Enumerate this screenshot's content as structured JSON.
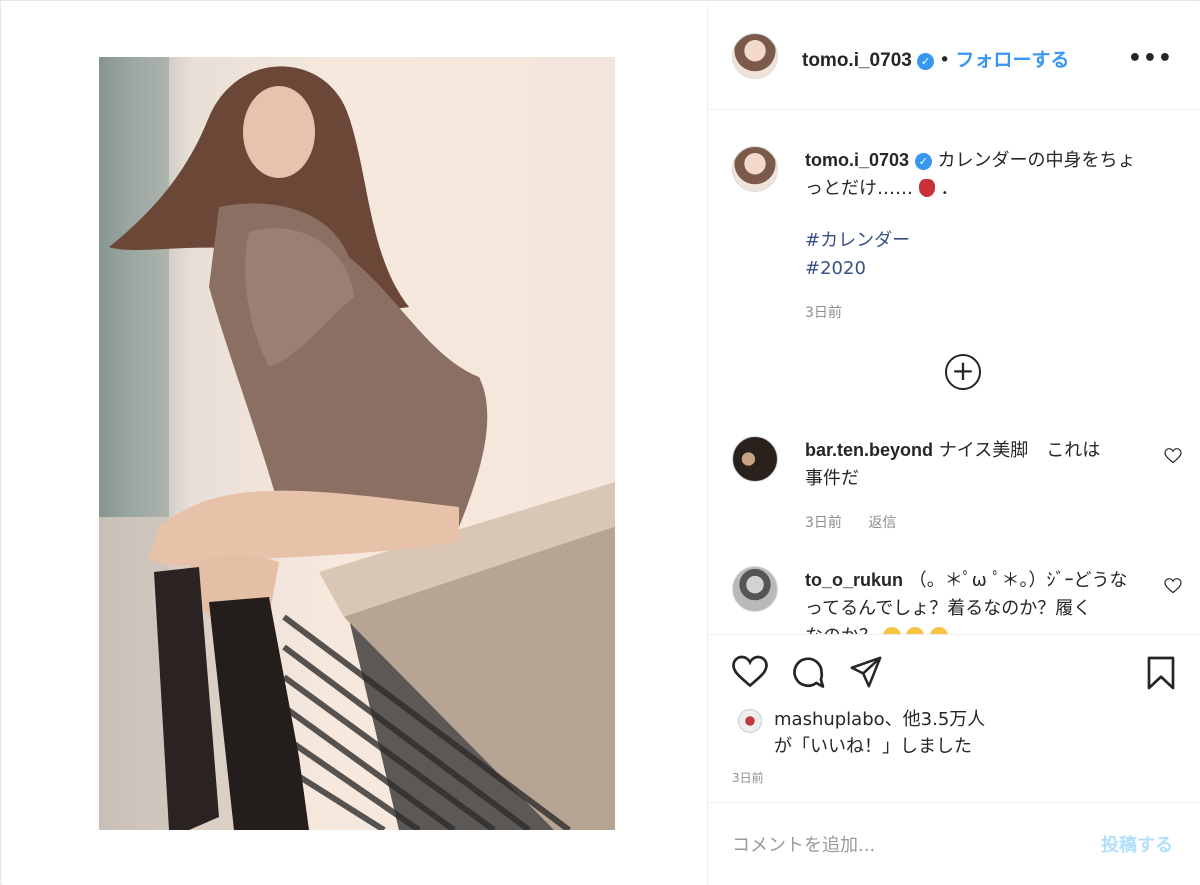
{
  "header": {
    "username": "tomo.i_0703",
    "separator": "•",
    "follow_label": "フォローする",
    "more_label": "•••"
  },
  "caption": {
    "username": "tomo.i_0703",
    "text_line1": "カレンダーの中身をちょ",
    "text_line2": "っとだけ……",
    "emoji_trailing": "．",
    "hashtag1": "#カレンダー",
    "hashtag2": "#2020",
    "time": "3日前"
  },
  "load_more_label": "+",
  "comments": [
    {
      "username": "bar.ten.beyond",
      "text_line1": "ナイス美脚　これは",
      "text_line2": "事件だ",
      "time": "3日前",
      "reply_label": "返信"
    },
    {
      "username": "to_o_rukun",
      "text_line1": "（。＊ﾟω ﾟ＊。）ｼﾞｰどうな",
      "text_line2": "ってるんでしょ？着るなのか？履く",
      "text_line3": "なのか？"
    }
  ],
  "likes": {
    "line1": "mashuplabo、他3.5万人",
    "line2": "が「いいね！」しました"
  },
  "post_time": "3日前",
  "add_comment": {
    "placeholder": "コメントを追加...",
    "post_label": "投稿する"
  },
  "colors": {
    "accent": "#3897f0",
    "hashtag": "#385185",
    "muted": "#8e8e8e"
  },
  "icons": [
    "more-icon",
    "verified-icon",
    "heart-icon",
    "comment-icon",
    "share-icon",
    "bookmark-icon",
    "plus-circle-icon"
  ]
}
